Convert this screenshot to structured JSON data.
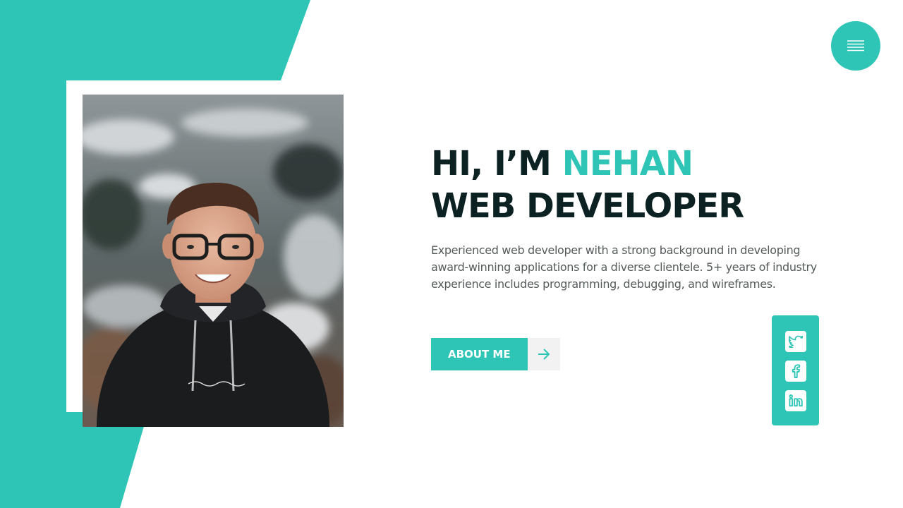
{
  "theme": {
    "accent": "#2ec5b6",
    "heading": "#0c2222",
    "body_text": "#555a5a",
    "background": "#ffffff"
  },
  "header": {
    "menu_icon": "hamburger-menu-icon"
  },
  "hero": {
    "greeting": "HI, I’M",
    "name": "NEHAN",
    "role": "WEB DEVELOPER",
    "bio": "Experienced web developer with a strong background in developing award-winning applications for a diverse clientele. 5+ years of industry experience includes programming, debugging, and wireframes.",
    "cta_label": "ABOUT ME",
    "cta_icon": "arrow-right-icon"
  },
  "social": {
    "items": [
      {
        "name": "twitter",
        "icon": "twitter-icon"
      },
      {
        "name": "facebook",
        "icon": "facebook-icon"
      },
      {
        "name": "linkedin",
        "icon": "linkedin-icon"
      }
    ]
  },
  "photo": {
    "subject": "portrait-photo"
  }
}
